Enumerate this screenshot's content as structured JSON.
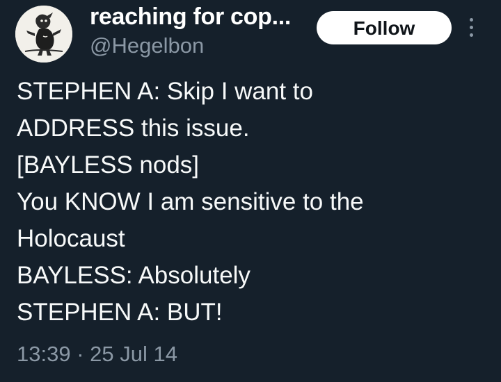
{
  "author": {
    "display_name": "reaching for cop...",
    "handle": "@Hegelbon",
    "avatar_icon": "cartoon-figure-avatar"
  },
  "follow_button": {
    "label": "Follow"
  },
  "more_menu": {
    "icon": "more-vertical-icon"
  },
  "tweet": {
    "lines": [
      "STEPHEN A: Skip I want to",
      "ADDRESS this issue.",
      "[BAYLESS nods]",
      "You KNOW I am sensitive to the",
      "Holocaust",
      "BAYLESS: Absolutely",
      "STEPHEN A: BUT!"
    ],
    "timestamp": "13:39 · 25 Jul 14"
  },
  "colors": {
    "background": "#15202b",
    "text_primary": "#f7f9f9",
    "text_secondary": "#8b98a5",
    "button_bg": "#ffffff",
    "button_text": "#0f1419"
  }
}
